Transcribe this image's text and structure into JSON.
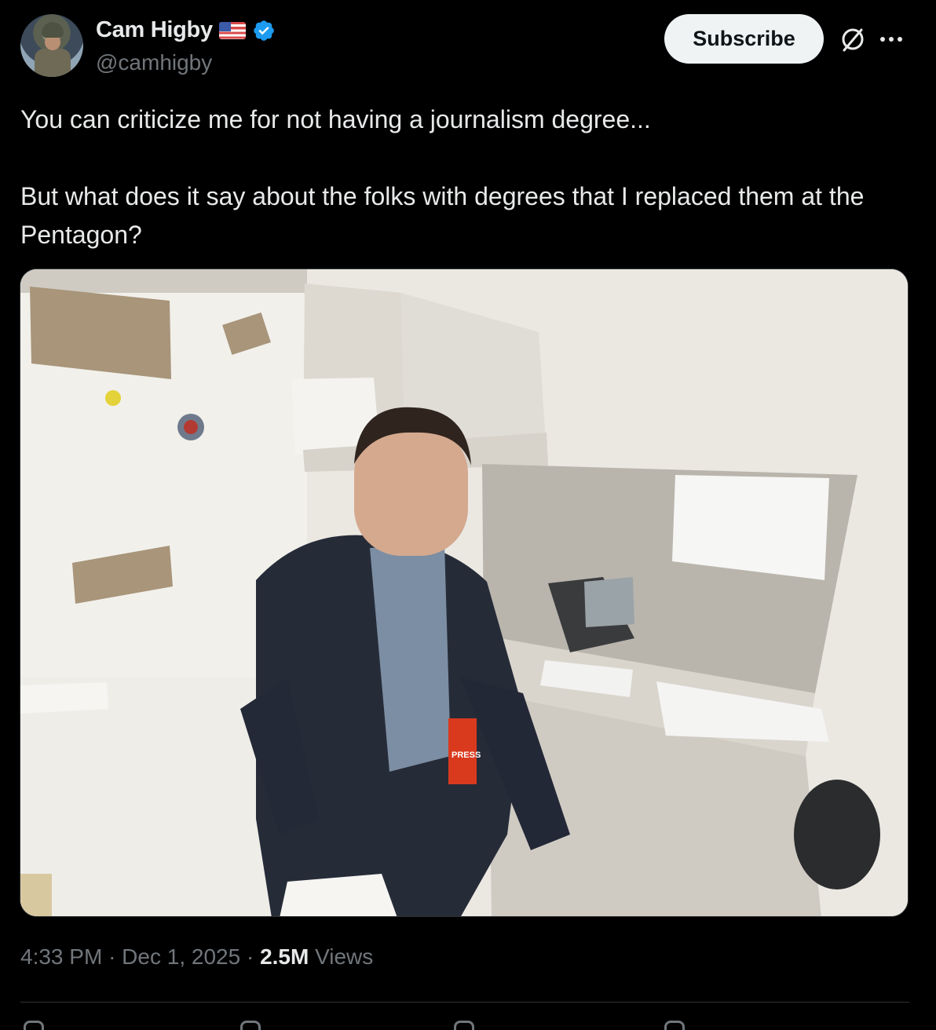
{
  "author": {
    "display_name": "Cam Higby",
    "handle": "@camhigby",
    "flag_icon": "us-flag-icon",
    "verified_icon": "verified-badge-icon",
    "verified_color": "#1d9bf0"
  },
  "actions": {
    "subscribe_label": "Subscribe",
    "grok_icon": "grok-icon",
    "more_icon": "more-options-icon"
  },
  "tweet": {
    "line1": "You can criticize me for not having a journalism degree...",
    "line2": "But what does it say about the folks with degrees that I replaced them at the Pentagon?",
    "media": {
      "description_icon": "photo",
      "badge_text": "PRESS"
    }
  },
  "meta": {
    "time": "4:33 PM",
    "separator": "·",
    "date": "Dec 1, 2025",
    "views_count": "2.5M",
    "views_label": "Views"
  },
  "colors": {
    "background": "#000000",
    "text": "#e7e9ea",
    "muted": "#71767b",
    "subscribe_bg": "#eff3f4",
    "border": "#2f3336"
  }
}
